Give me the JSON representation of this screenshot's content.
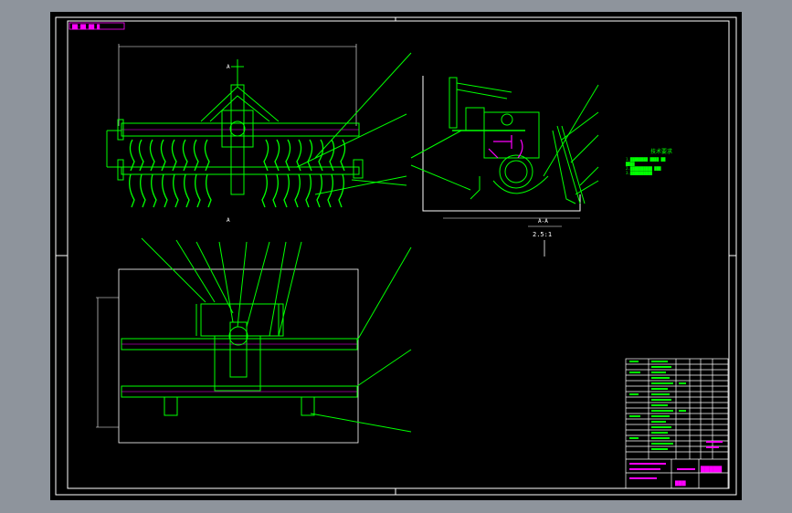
{
  "app": {
    "viewport_bg": "#000000",
    "chrome_bg": "#8e949c"
  },
  "colors": {
    "frame": "#ffffff",
    "geometry": "#00ff00",
    "hatch": "#ffffff",
    "leader": "#00ff00",
    "highlight": "#ff00ff",
    "dim": "#ffffff"
  },
  "drawing": {
    "tag": "██-██ ██ █",
    "section_label": "A-A",
    "section_scale": "2.5:1",
    "cut_marker_top": "A",
    "cut_marker_bottom": "A"
  },
  "notes": {
    "heading": "技术要求",
    "lines": [
      "1.████████ ████ ██",
      "████",
      "2.██████████ ███",
      "3.██████████"
    ]
  },
  "title_block": {
    "drawing_name": "█████",
    "part_name": "███"
  }
}
